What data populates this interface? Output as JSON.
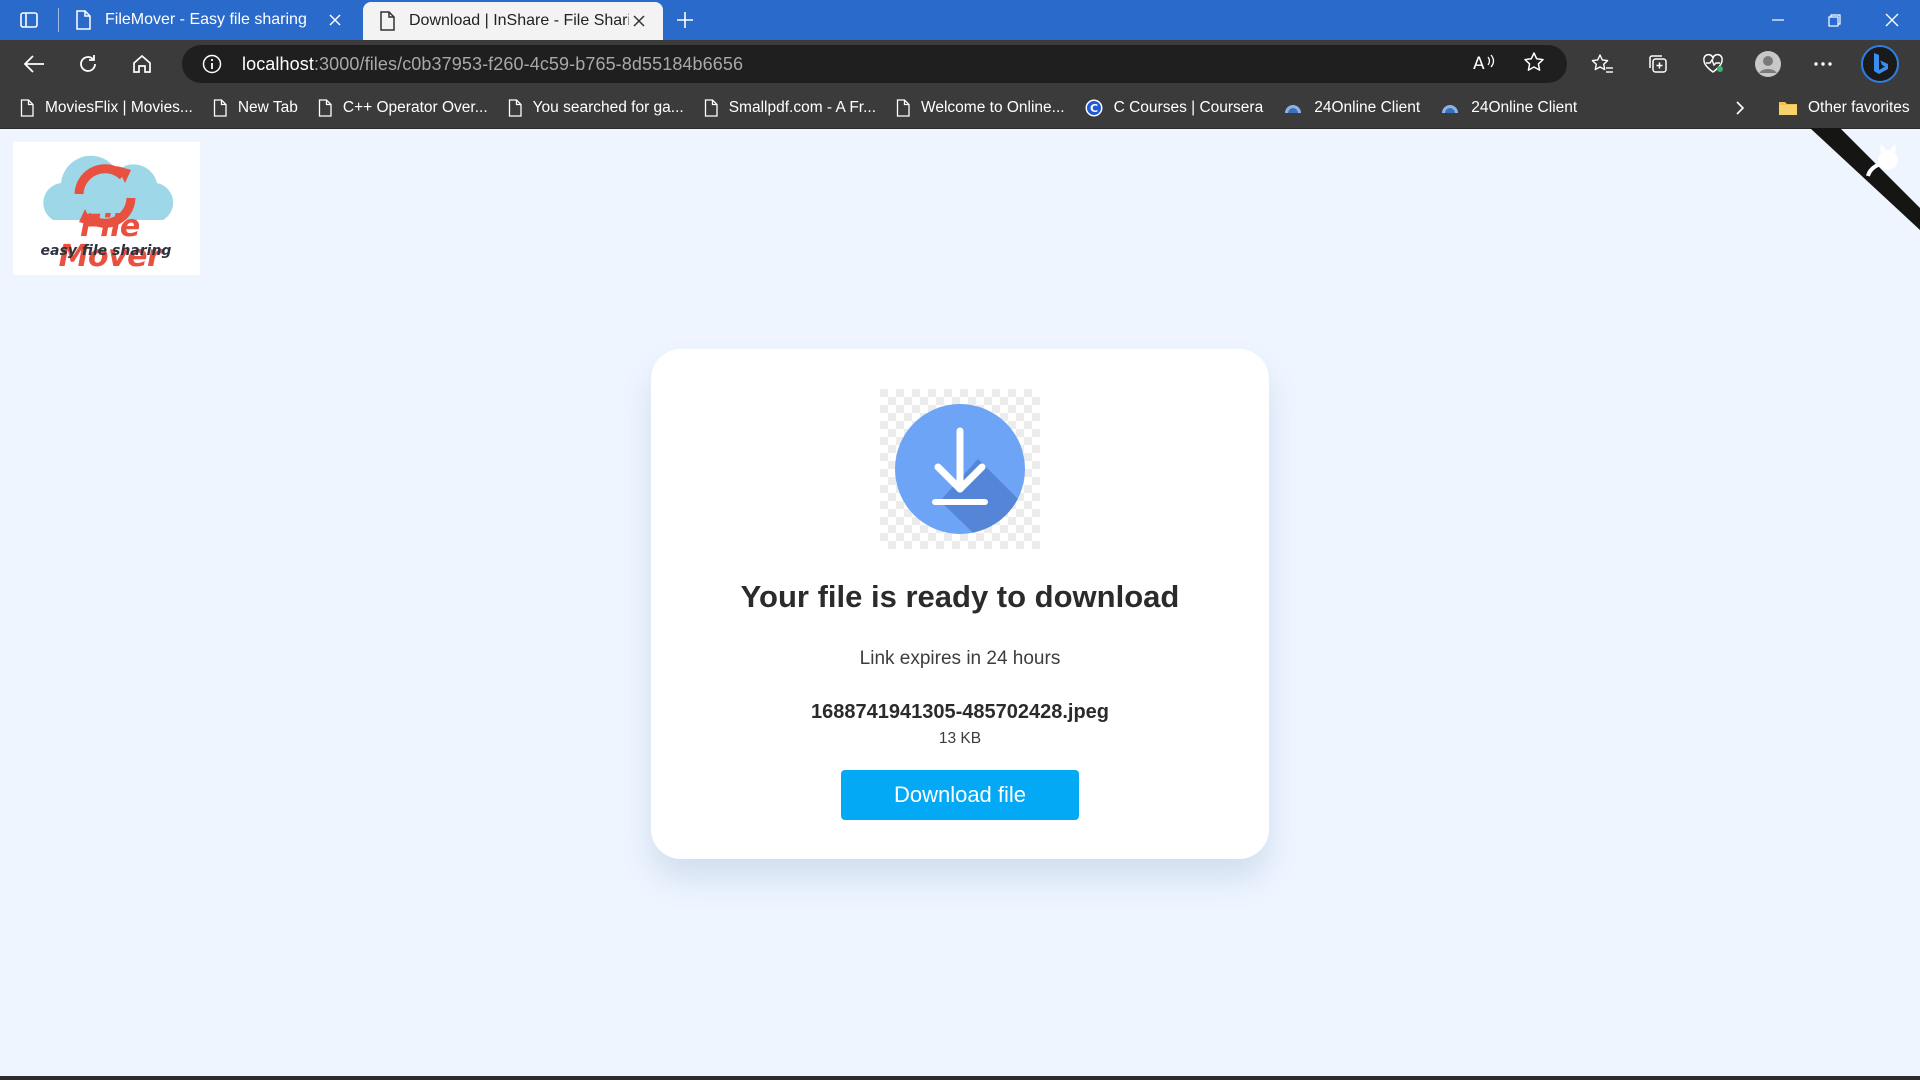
{
  "browser": {
    "tabs": [
      {
        "title": "FileMover - Easy file sharing",
        "active": false
      },
      {
        "title": "Download | InShare - File Sharing",
        "active": true
      }
    ],
    "address": {
      "host": "localhost",
      "path": ":3000/files/c0b37953-f260-4c59-b765-8d55184b6656"
    },
    "bookmarks": [
      {
        "label": "MoviesFlix | Movies...",
        "icon": "page-icon"
      },
      {
        "label": "New Tab",
        "icon": "page-icon"
      },
      {
        "label": "C++ Operator Over...",
        "icon": "page-icon"
      },
      {
        "label": "You searched for ga...",
        "icon": "page-icon"
      },
      {
        "label": "Smallpdf.com - A Fr...",
        "icon": "page-icon"
      },
      {
        "label": "Welcome to Online...",
        "icon": "page-icon"
      },
      {
        "label": "C Courses | Coursera",
        "icon": "coursera-icon"
      },
      {
        "label": "24Online Client",
        "icon": "cloud-icon"
      },
      {
        "label": "24Online Client",
        "icon": "cloud-icon"
      }
    ],
    "other_favorites": "Other favorites"
  },
  "page": {
    "logo": {
      "name": "File Mover",
      "tagline": "easy file sharing"
    },
    "card": {
      "heading": "Your file is ready to download",
      "expiry": "Link expires in 24 hours",
      "file_name": "1688741941305-485702428.jpeg",
      "file_size": "13 KB",
      "button_label": "Download file"
    }
  },
  "colors": {
    "accent": "#03a9f4",
    "page_background": "#eef5ff",
    "titlebar": "#2a6acb",
    "logo_red": "#e8503f",
    "download_circle": "#6ea4f5"
  }
}
